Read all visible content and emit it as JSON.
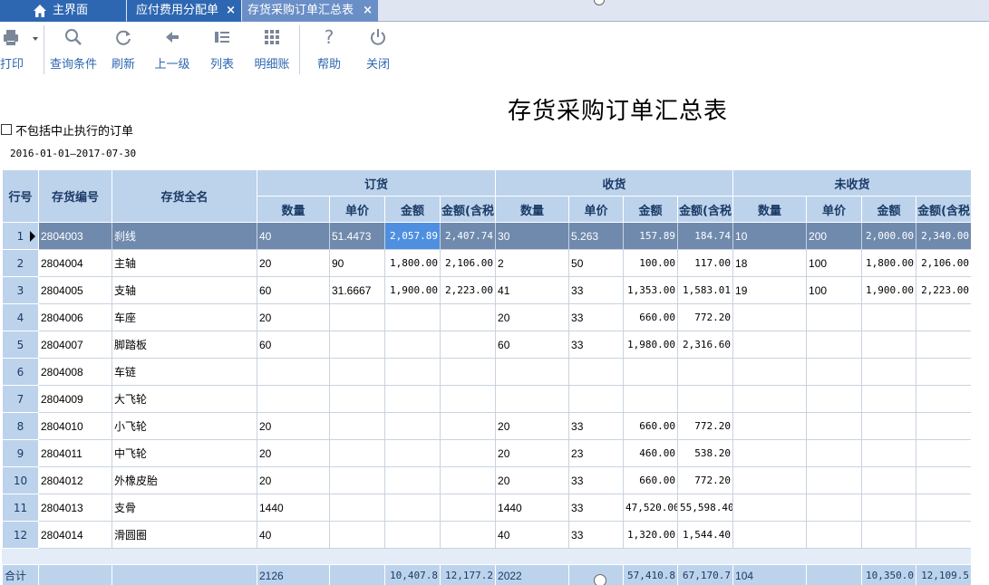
{
  "tabs": [
    {
      "label": "主界面"
    },
    {
      "label": "应付费用分配单"
    },
    {
      "label": "存货采购订单汇总表"
    }
  ],
  "tab_close_glyph": "×",
  "toolbar": {
    "print": "打印",
    "query": "查询条件",
    "refresh": "刷新",
    "up": "上一级",
    "columns": "列表",
    "detail": "明细账",
    "help": "帮助",
    "close": "关闭"
  },
  "report": {
    "title": "存货采购订单汇总表",
    "filter_label": "不包括中止执行的订单",
    "filter_checked": false,
    "date_range": "2016-01-01—2017-07-30"
  },
  "grid": {
    "headers": {
      "row_no": "行号",
      "code": "存货编号",
      "name": "存货全名",
      "group_order": "订货",
      "group_received": "收货",
      "group_pending": "未收货",
      "qty": "数量",
      "price": "单价",
      "amount": "金额",
      "amount_tax": "金额(含税"
    },
    "rows": [
      {
        "no": "1",
        "code": "2804003",
        "name": "刹线",
        "o_qty": "40",
        "o_price": "51.4473",
        "o_amt": "2,057.89",
        "o_tax": "2,407.74",
        "r_qty": "30",
        "r_price": "5.263",
        "r_amt": "157.89",
        "r_tax": "184.74",
        "p_qty": "10",
        "p_price": "200",
        "p_amt": "2,000.00",
        "p_tax": "2,340.00"
      },
      {
        "no": "2",
        "code": "2804004",
        "name": "主轴",
        "o_qty": "20",
        "o_price": "90",
        "o_amt": "1,800.00",
        "o_tax": "2,106.00",
        "r_qty": "2",
        "r_price": "50",
        "r_amt": "100.00",
        "r_tax": "117.00",
        "p_qty": "18",
        "p_price": "100",
        "p_amt": "1,800.00",
        "p_tax": "2,106.00"
      },
      {
        "no": "3",
        "code": "2804005",
        "name": "支轴",
        "o_qty": "60",
        "o_price": "31.6667",
        "o_amt": "1,900.00",
        "o_tax": "2,223.00",
        "r_qty": "41",
        "r_price": "33",
        "r_amt": "1,353.00",
        "r_tax": "1,583.01",
        "p_qty": "19",
        "p_price": "100",
        "p_amt": "1,900.00",
        "p_tax": "2,223.00"
      },
      {
        "no": "4",
        "code": "2804006",
        "name": "车座",
        "o_qty": "20",
        "o_price": "",
        "o_amt": "",
        "o_tax": "",
        "r_qty": "20",
        "r_price": "33",
        "r_amt": "660.00",
        "r_tax": "772.20",
        "p_qty": "",
        "p_price": "",
        "p_amt": "",
        "p_tax": ""
      },
      {
        "no": "5",
        "code": "2804007",
        "name": "脚踏板",
        "o_qty": "60",
        "o_price": "",
        "o_amt": "",
        "o_tax": "",
        "r_qty": "60",
        "r_price": "33",
        "r_amt": "1,980.00",
        "r_tax": "2,316.60",
        "p_qty": "",
        "p_price": "",
        "p_amt": "",
        "p_tax": ""
      },
      {
        "no": "6",
        "code": "2804008",
        "name": "车链",
        "o_qty": "",
        "o_price": "",
        "o_amt": "",
        "o_tax": "",
        "r_qty": "",
        "r_price": "",
        "r_amt": "",
        "r_tax": "",
        "p_qty": "",
        "p_price": "",
        "p_amt": "",
        "p_tax": ""
      },
      {
        "no": "7",
        "code": "2804009",
        "name": "大飞轮",
        "o_qty": "",
        "o_price": "",
        "o_amt": "",
        "o_tax": "",
        "r_qty": "",
        "r_price": "",
        "r_amt": "",
        "r_tax": "",
        "p_qty": "",
        "p_price": "",
        "p_amt": "",
        "p_tax": ""
      },
      {
        "no": "8",
        "code": "2804010",
        "name": "小飞轮",
        "o_qty": "20",
        "o_price": "",
        "o_amt": "",
        "o_tax": "",
        "r_qty": "20",
        "r_price": "33",
        "r_amt": "660.00",
        "r_tax": "772.20",
        "p_qty": "",
        "p_price": "",
        "p_amt": "",
        "p_tax": ""
      },
      {
        "no": "9",
        "code": "2804011",
        "name": "中飞轮",
        "o_qty": "20",
        "o_price": "",
        "o_amt": "",
        "o_tax": "",
        "r_qty": "20",
        "r_price": "23",
        "r_amt": "460.00",
        "r_tax": "538.20",
        "p_qty": "",
        "p_price": "",
        "p_amt": "",
        "p_tax": ""
      },
      {
        "no": "10",
        "code": "2804012",
        "name": "外橡皮胎",
        "o_qty": "20",
        "o_price": "",
        "o_amt": "",
        "o_tax": "",
        "r_qty": "20",
        "r_price": "33",
        "r_amt": "660.00",
        "r_tax": "772.20",
        "p_qty": "",
        "p_price": "",
        "p_amt": "",
        "p_tax": ""
      },
      {
        "no": "11",
        "code": "2804013",
        "name": "支骨",
        "o_qty": "1440",
        "o_price": "",
        "o_amt": "",
        "o_tax": "",
        "r_qty": "1440",
        "r_price": "33",
        "r_amt": "47,520.00",
        "r_tax": "55,598.40",
        "p_qty": "",
        "p_price": "",
        "p_amt": "",
        "p_tax": ""
      },
      {
        "no": "12",
        "code": "2804014",
        "name": "滑圆圈",
        "o_qty": "40",
        "o_price": "",
        "o_amt": "",
        "o_tax": "",
        "r_qty": "40",
        "r_price": "33",
        "r_amt": "1,320.00",
        "r_tax": "1,544.40",
        "p_qty": "",
        "p_price": "",
        "p_amt": "",
        "p_tax": ""
      }
    ],
    "total": {
      "label": "合计",
      "o_qty": "2126",
      "o_amt": "10,407.8",
      "o_tax": "12,177.2",
      "r_qty": "2022",
      "r_amt": "57,410.8",
      "r_tax": "67,170.7",
      "p_qty": "104",
      "p_amt": "10,350.0",
      "p_tax": "12,109.5"
    }
  },
  "colors": {
    "tab_active": "#2e67b1",
    "tab_current": "#6a8fc7",
    "header_bg": "#bdd3ec",
    "selected_row": "#6f8aad",
    "focused_cell": "#4f8fe0",
    "toolbar_text": "#2e67b1"
  }
}
